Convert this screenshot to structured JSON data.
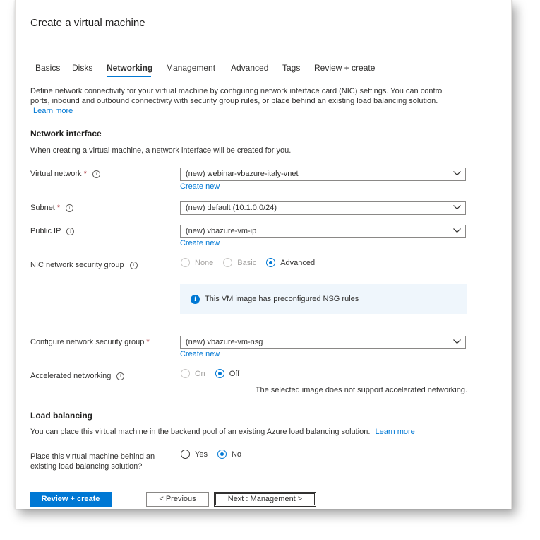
{
  "window": {
    "title": "Create a virtual machine"
  },
  "tabs": [
    {
      "label": "Basics"
    },
    {
      "label": "Disks"
    },
    {
      "label": "Networking",
      "active": true
    },
    {
      "label": "Management"
    },
    {
      "label": "Advanced"
    },
    {
      "label": "Tags"
    },
    {
      "label": "Review + create"
    }
  ],
  "intro": {
    "text": "Define network connectivity for your virtual machine by configuring network interface card (NIC) settings. You can control ports, inbound and outbound connectivity with security group rules, or place behind an existing load balancing solution.",
    "learn_more": "Learn more"
  },
  "network_interface": {
    "heading": "Network interface",
    "description": "When creating a virtual machine, a network interface will be created for you.",
    "virtual_network": {
      "label": "Virtual network",
      "value": "(new) webinar-vbazure-italy-vnet",
      "create_new": "Create new"
    },
    "subnet": {
      "label": "Subnet",
      "value": "(new) default (10.1.0.0/24)"
    },
    "public_ip": {
      "label": "Public IP",
      "value": "(new) vbazure-vm-ip",
      "create_new": "Create new"
    },
    "nic_nsg": {
      "label": "NIC network security group",
      "options": [
        "None",
        "Basic",
        "Advanced"
      ],
      "selected": "Advanced",
      "info": "This VM image has preconfigured NSG rules"
    },
    "configure_nsg": {
      "label": "Configure network security group",
      "value": "(new) vbazure-vm-nsg",
      "create_new": "Create new"
    },
    "accelerated": {
      "label": "Accelerated networking",
      "options": [
        "On",
        "Off"
      ],
      "selected": "Off",
      "note": "The selected image does not support accelerated networking."
    }
  },
  "load_balancing": {
    "heading": "Load balancing",
    "description": "You can place this virtual machine in the backend pool of an existing Azure load balancing solution.",
    "learn_more": "Learn more",
    "question_line1": "Place this virtual machine behind an",
    "question_line2": "existing load balancing solution?",
    "options": [
      "Yes",
      "No"
    ],
    "selected": "No"
  },
  "footer": {
    "review_create": "Review + create",
    "previous": "< Previous",
    "next": "Next : Management >"
  },
  "icons": {
    "info": "info-circle-icon",
    "chevron": "chevron-down-icon",
    "info_filled": "info-filled-icon"
  },
  "colors": {
    "accent": "#0078d4",
    "required": "#a4262c",
    "info_bg": "#eff6fc"
  }
}
